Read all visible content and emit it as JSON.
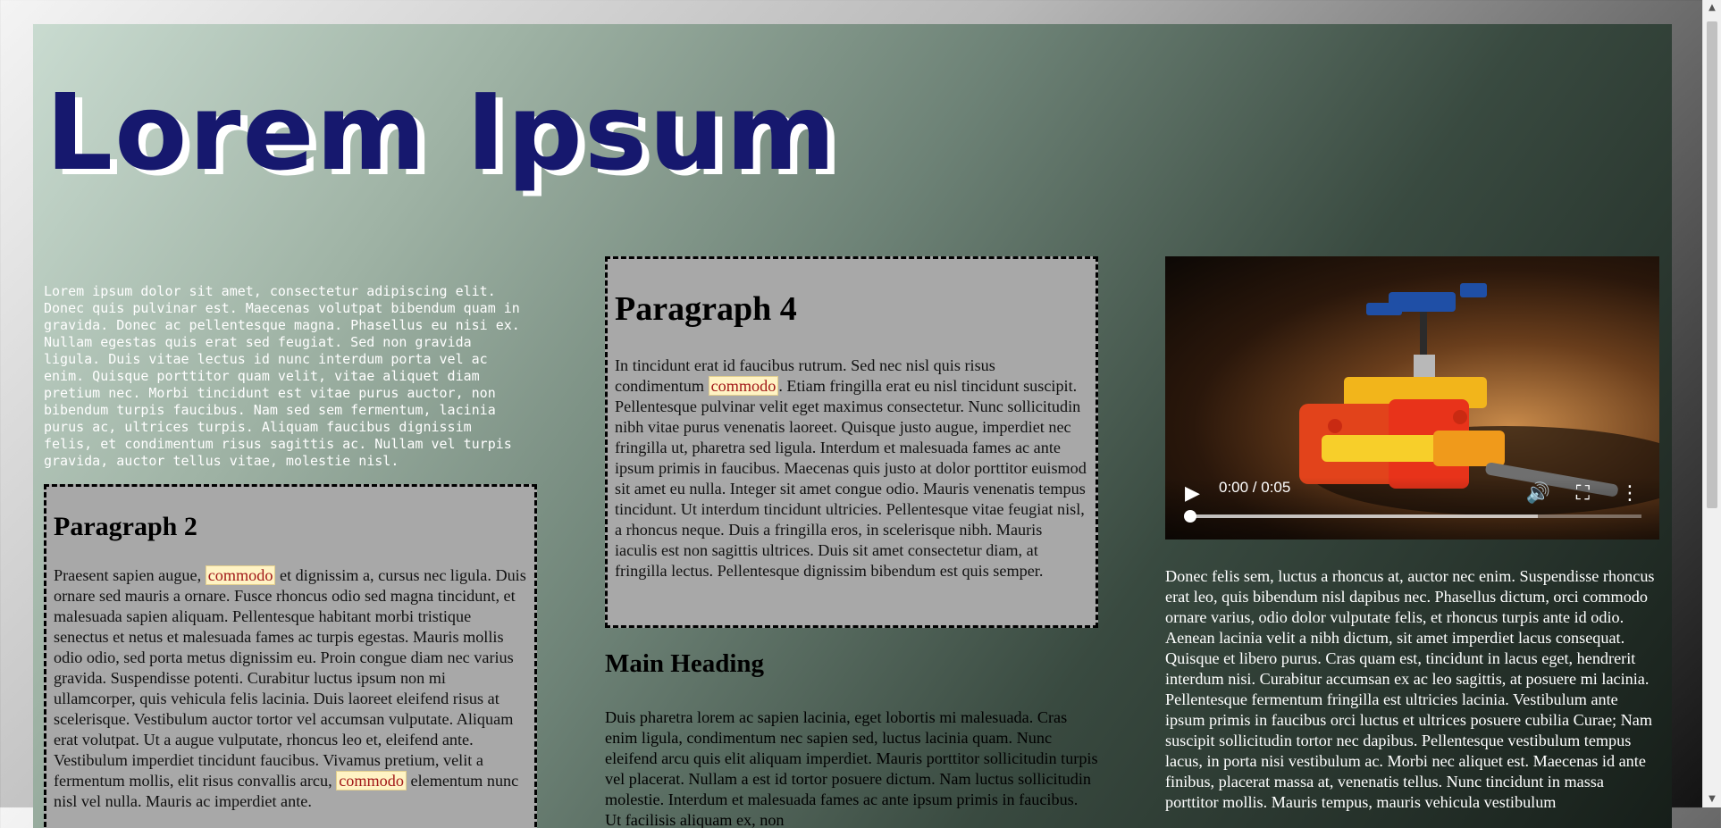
{
  "page": {
    "title": "Lorem Ipsum",
    "intro": "Lorem ipsum dolor sit amet, consectetur adipiscing elit. Donec quis pulvinar est. Maecenas volutpat bibendum quam in gravida. Donec ac pellentesque magna. Phasellus eu nisi ex. Nullam egestas quis erat sed feugiat. Sed non gravida ligula. Duis vitae lectus id nunc interdum porta vel ac enim. Quisque porttitor quam velit, vitae aliquet diam pretium nec. Morbi tincidunt est vitae purus auctor, non bibendum turpis faucibus. Nam sed sem fermentum, lacinia purus ac, ultrices turpis. Aliquam faucibus dignissim felis, et condimentum risus sagittis ac. Nullam vel turpis gravida, auctor tellus vitae, molestie nisl."
  },
  "paragraph2": {
    "heading": "Paragraph 2",
    "text_before": "Praesent sapien augue, ",
    "highlight_1": "commodo",
    "text_middle": " et dignissim a, cursus nec ligula. Duis ornare sed mauris a ornare. Fusce rhoncus odio sed magna tincidunt, et malesuada sapien aliquam. Pellentesque habitant morbi tristique senectus et netus et malesuada fames ac turpis egestas. Mauris mollis odio odio, sed porta metus dignissim eu. Proin congue diam nec varius gravida. Suspendisse potenti. Curabitur luctus ipsum non mi ullamcorper, quis vehicula felis lacinia. Duis laoreet eleifend risus at scelerisque. Vestibulum auctor tortor vel accumsan vulputate. Aliquam erat volutpat. Ut a augue vulputate, rhoncus leo et, eleifend ante. Vestibulum imperdiet tincidunt faucibus. Vivamus pretium, velit a fermentum mollis, elit risus convallis arcu, ",
    "highlight_2": "commodo",
    "text_after": " elementum nunc nisl vel nulla. Mauris ac imperdiet ante."
  },
  "paragraph4": {
    "heading": "Paragraph 4",
    "text_before": "In tincidunt erat id faucibus rutrum. Sed nec nisl quis risus condimentum ",
    "highlight": "commodo",
    "text_after": ". Etiam fringilla erat eu nisl tincidunt suscipit. Pellentesque pulvinar velit eget maximus consectetur. Nunc sollicitudin nibh vitae purus venenatis laoreet. Quisque justo augue, imperdiet nec fringilla ut, pharetra sed ligula. Interdum et malesuada fames ac ante ipsum primis in faucibus. Maecenas quis justo at dolor porttitor euismod sit amet eu nulla. Integer sit amet congue odio. Mauris venenatis tempus tincidunt. Ut interdum tincidunt ultricies. Pellentesque vitae feugiat nisl, a rhoncus neque. Duis a fringilla eros, in scelerisque nibh. Mauris iaculis est non sagittis ultrices. Duis sit amet consectetur diam, at fringilla lectus. Pellentesque dignissim bibendum est quis semper."
  },
  "main_section": {
    "heading": "Main Heading",
    "text": "Duis pharetra lorem ac sapien lacinia, eget lobortis mi malesuada. Cras enim ligula, condimentum nec sapien sed, luctus lacinia quam. Nunc eleifend arcu quis elit aliquam imperdiet. Mauris porttitor sollicitudin turpis vel placerat. Nullam a est id tortor posuere dictum. Nam luctus sollicitudin molestie. Interdum et malesuada fames ac ante ipsum primis in faucibus. Ut facilisis aliquam ex, non"
  },
  "video": {
    "time": "0:00 / 0:05",
    "progress": 0,
    "buffered": 0.77
  },
  "right_text": "Donec felis sem, luctus a rhoncus at, auctor nec enim. Suspendisse rhoncus erat leo, quis bibendum nisl dapibus nec. Phasellus dictum, orci commodo ornare varius, odio dolor vulputate felis, et rhoncus turpis ante id odio. Aenean lacinia velit a nibh dictum, sit amet imperdiet lacus consequat. Quisque et libero purus. Cras quam est, tincidunt in lacus eget, hendrerit interdum nisi. Curabitur accumsan ex ac leo sagittis, at posuere mi lacinia. Pellentesque fermentum fringilla est ultricies lacinia. Vestibulum ante ipsum primis in faucibus orci luctus et ultrices posuere cubilia Curae; Nam suscipit sollicitudin tortor nec dapibus. Pellentesque vestibulum tempus lacus, in porta nisi vestibulum ac. Morbi nec aliquet est. Maecenas id ante finibus, placerat massa at, venenatis tellus. Nunc tincidunt in massa porttitor mollis. Mauris tempus, mauris vehicula vestibulum",
  "colors": {
    "title": "#16186e",
    "title_shadow": "#ffffff",
    "box_background": "#a8a8a8",
    "highlight_background": "#fff3c4",
    "highlight_text": "#a21818"
  },
  "icons": {
    "play": "play-icon",
    "volume": "volume-icon",
    "fullscreen": "fullscreen-icon",
    "more": "more-options-icon"
  }
}
